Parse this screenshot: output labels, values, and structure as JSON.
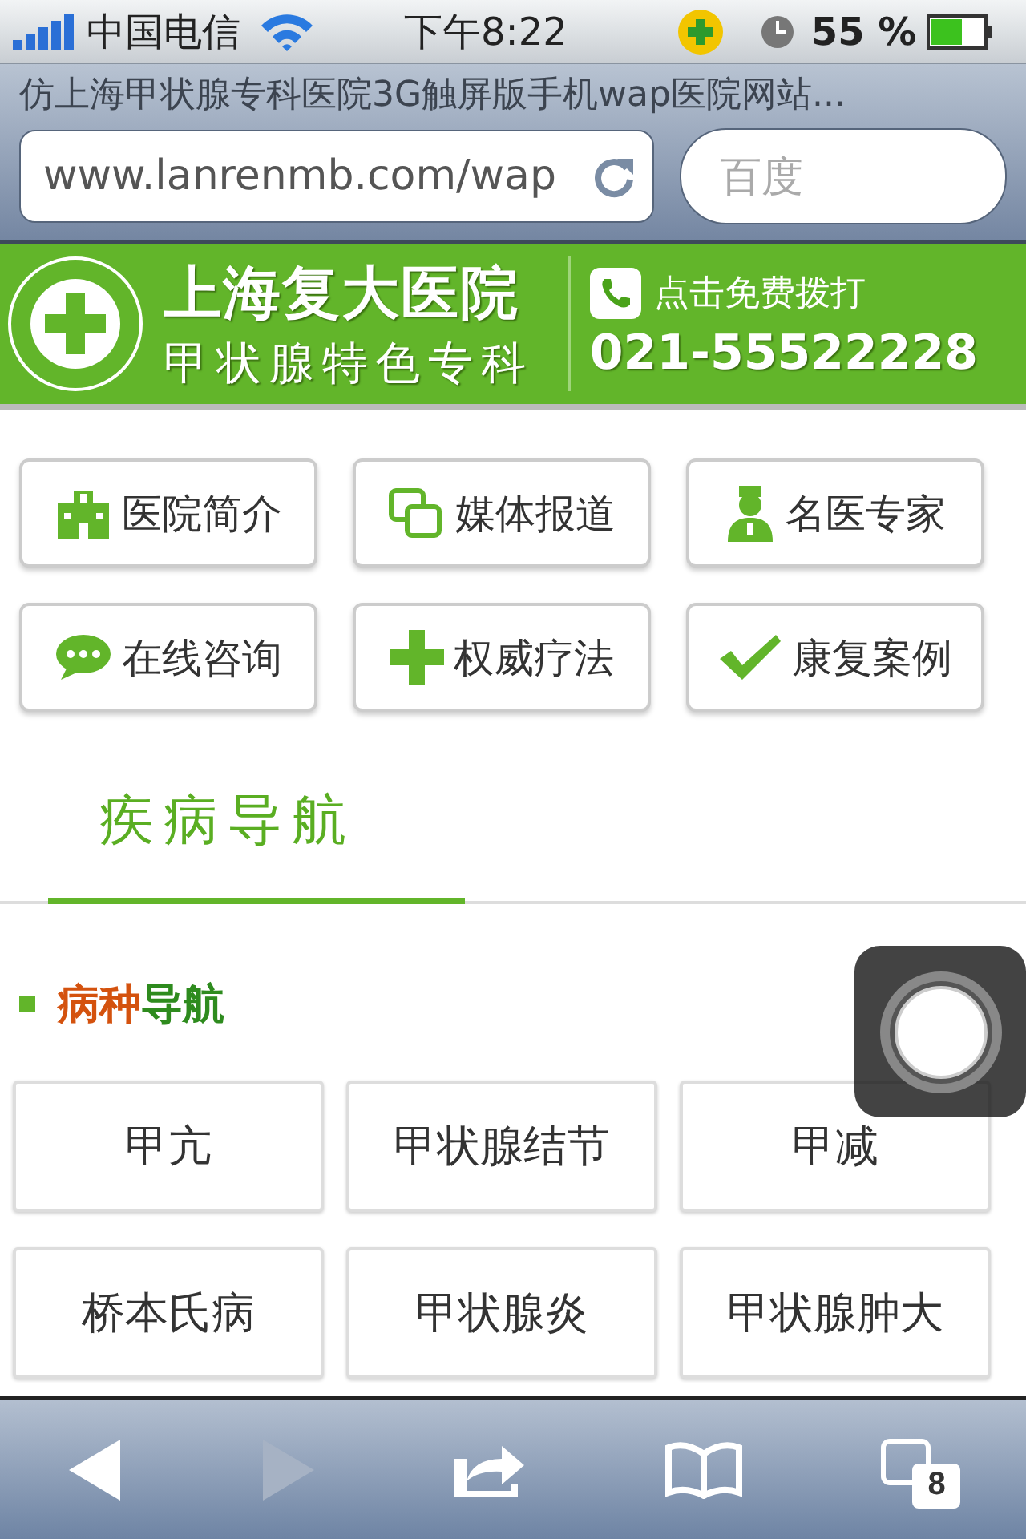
{
  "status_bar": {
    "carrier": "中国电信",
    "time": "下午8:22",
    "battery": "55 %"
  },
  "browser": {
    "page_title": "仿上海甲状腺专科医院3G触屏版手机wap医院网站...",
    "url": "www.lanrenmb.com/wap",
    "search_placeholder": "百度"
  },
  "header": {
    "name": "上海复大医院",
    "subtitle": "甲状腺特色专科",
    "call_label": "点击免费拨打",
    "phone": "021-55522228"
  },
  "nav_items": [
    {
      "label": "医院简介"
    },
    {
      "label": "媒体报道"
    },
    {
      "label": "名医专家"
    },
    {
      "label": "在线咨询"
    },
    {
      "label": "权威疗法"
    },
    {
      "label": "康复案例"
    }
  ],
  "tabs": [
    {
      "label": "疾病导航",
      "selected": true
    }
  ],
  "section_title": {
    "lead": "病种",
    "rest": "导航"
  },
  "diseases": [
    "甲亢",
    "甲状腺结节",
    "甲减",
    "桥本氏病",
    "甲状腺炎",
    "甲状腺肿大"
  ],
  "toolbar": {
    "forward_disabled": true,
    "tab_count": "8"
  }
}
